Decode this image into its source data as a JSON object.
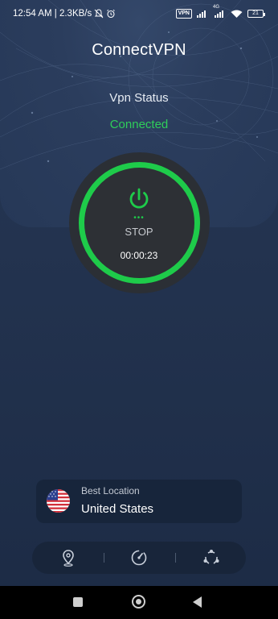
{
  "status_bar": {
    "time_speed": "12:54 AM | 2.3KB/s",
    "vpn_chip": "VPN",
    "network_type": "4G",
    "battery": "21"
  },
  "header": {
    "app_title": "ConnectVPN",
    "vpn_status_label": "Vpn Status",
    "vpn_status_value": "Connected"
  },
  "power_button": {
    "dots": "•••",
    "action_label": "STOP",
    "timer": "00:00:23"
  },
  "location": {
    "label": "Best Location",
    "country": "United States"
  },
  "bottom_nav": {
    "items": [
      "location-pin-icon",
      "speed-icon",
      "share-icon"
    ]
  },
  "colors": {
    "accent_green": "#1ecb4a",
    "status_green": "#2fce5a",
    "background": "#23334f",
    "card": "#17253b"
  }
}
